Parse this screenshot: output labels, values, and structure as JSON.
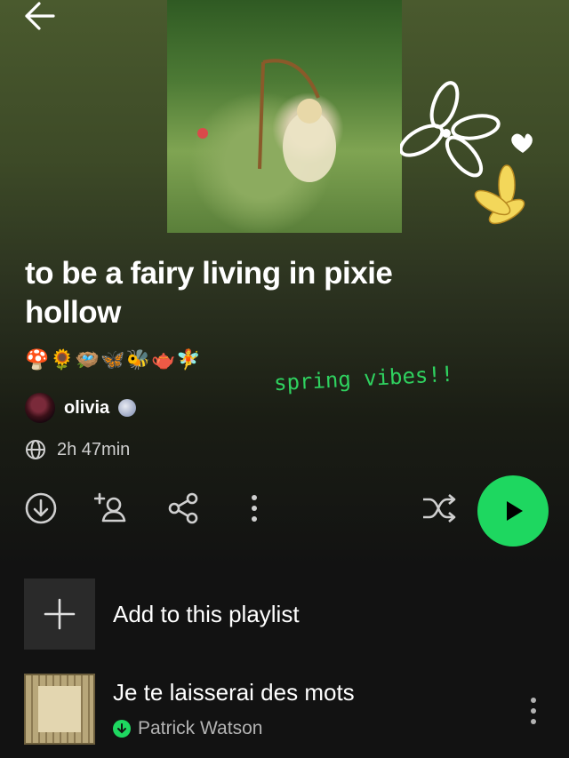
{
  "playlist": {
    "title": "to be a fairy living in pixie hollow",
    "emojis": "🍄🌻🪺🦋🐝🫖🧚",
    "description_note": "spring vibes!!",
    "owner": {
      "name": "olivia"
    },
    "duration": "2h 47min"
  },
  "actions": {
    "add_to_playlist_label": "Add to this playlist"
  },
  "tracks": [
    {
      "title": "Je te laisserai des mots",
      "artist": "Patrick Watson",
      "downloaded": true
    }
  ],
  "colors": {
    "accent": "#1ed760",
    "background": "#121212",
    "header_tint": "#4a5a2e"
  },
  "icons": [
    "back-arrow-icon",
    "download-icon",
    "add-user-icon",
    "share-icon",
    "more-icon",
    "shuffle-icon",
    "play-icon",
    "plus-icon",
    "globe-icon"
  ]
}
